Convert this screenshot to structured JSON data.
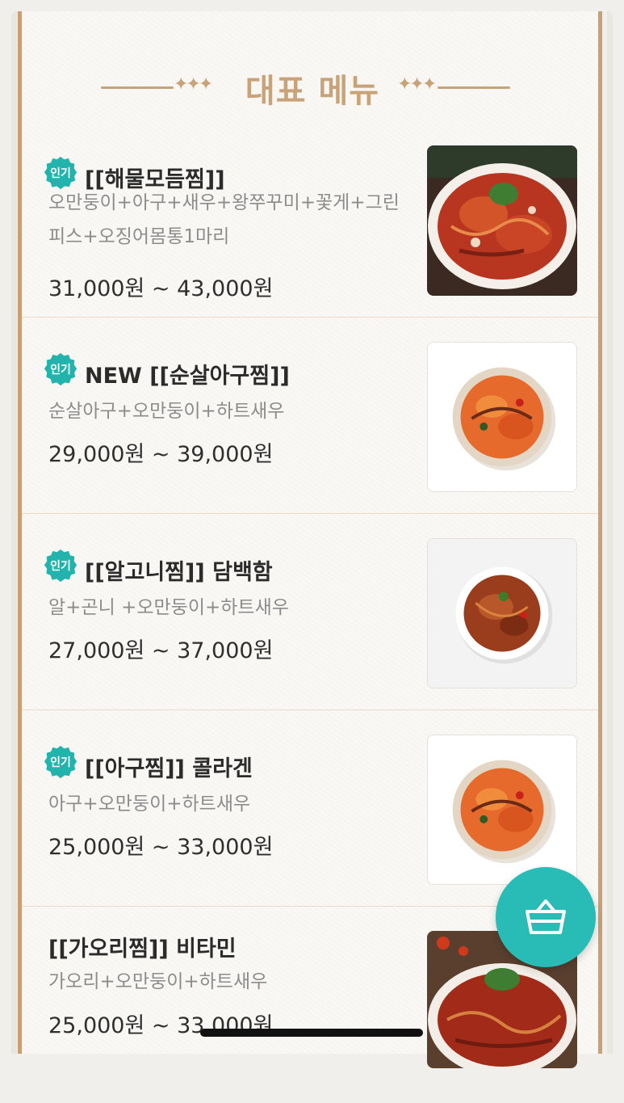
{
  "header": {
    "title": "대표 메뉴"
  },
  "menu": [
    {
      "badge": "인기",
      "title": "[[해물모듬찜]]",
      "description": "오만둥이+아구+새우+왕쭈꾸미+꽃게+그린피스+오징어몸통1마리",
      "price": "31,000원 ~ 43,000원"
    },
    {
      "badge": "인기",
      "title": "NEW [[순살아구찜]]",
      "description": "순살아구+오만둥이+하트새우",
      "price": "29,000원 ~ 39,000원"
    },
    {
      "badge": "인기",
      "title": "[[알고니찜]] 담백함",
      "description": "알+곤니 +오만둥이+하트새우",
      "price": "27,000원 ~ 37,000원"
    },
    {
      "badge": "인기",
      "title": "[[아구찜]] 콜라겐",
      "description": "아구+오만둥이+하트새우",
      "price": "25,000원 ~ 33,000원"
    },
    {
      "title": "[[가오리찜]] 비타민",
      "description": "가오리+오만둥이+하트새우",
      "price": "25,000원 ~ 33,000원"
    }
  ],
  "icons": {
    "cart": "basket-icon"
  },
  "colors": {
    "accent": "#c8a278",
    "badge": "#23b3ad",
    "cart": "#29bcb7",
    "frame": "#c99f74"
  }
}
